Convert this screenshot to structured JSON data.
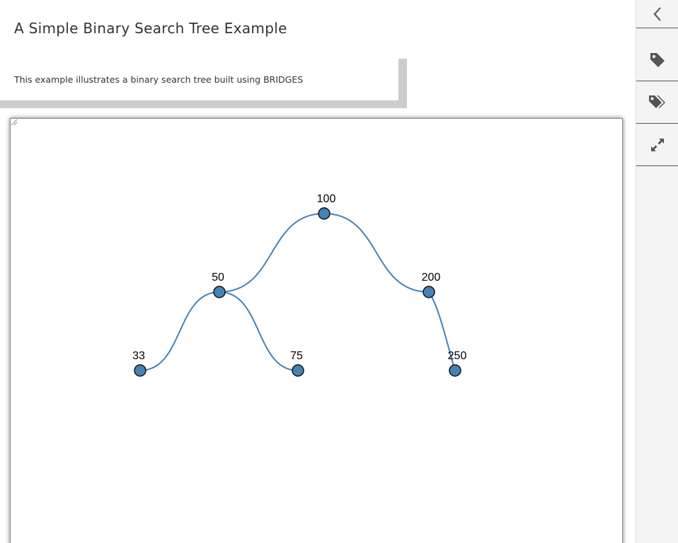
{
  "header": {
    "title": "A Simple Binary Search Tree Example"
  },
  "description": {
    "text": "This example illustrates a binary search tree built using BRIDGES"
  },
  "tree": {
    "node_color": "#4682b4",
    "edge_color": "#4682b4",
    "nodes": [
      {
        "label": "100"
      },
      {
        "label": "50"
      },
      {
        "label": "200"
      },
      {
        "label": "33"
      },
      {
        "label": "75"
      },
      {
        "label": "250"
      }
    ],
    "edges": [
      {
        "from": "100",
        "to": "50"
      },
      {
        "from": "100",
        "to": "200"
      },
      {
        "from": "50",
        "to": "33"
      },
      {
        "from": "50",
        "to": "75"
      },
      {
        "from": "200",
        "to": "250"
      }
    ]
  },
  "sidebar": {
    "buttons": [
      {
        "icon": "chevron-left-icon"
      },
      {
        "icon": "tag-icon"
      },
      {
        "icon": "tags-icon"
      },
      {
        "icon": "expand-icon"
      }
    ]
  }
}
